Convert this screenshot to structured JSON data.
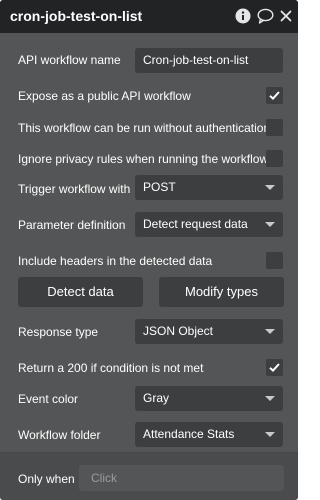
{
  "title": "cron-job-test-on-list",
  "icons": [
    "info-icon",
    "comment-icon",
    "close-icon"
  ],
  "fields": {
    "api_workflow_name": {
      "label": "API workflow name",
      "value": "Cron-job-test-on-list"
    },
    "expose_public": {
      "label": "Expose as a public API workflow",
      "checked": true
    },
    "no_auth": {
      "label": "This workflow can be run without authentication",
      "checked": false
    },
    "ignore_privacy": {
      "label": "Ignore privacy rules when running the workflow",
      "checked": false
    },
    "trigger": {
      "label": "Trigger workflow with",
      "value": "POST"
    },
    "parameter_definition": {
      "label": "Parameter definition",
      "value": "Detect request data"
    },
    "include_headers": {
      "label": "Include headers in the detected data",
      "checked": false
    },
    "response_type": {
      "label": "Response type",
      "value": "JSON Object"
    },
    "return_200": {
      "label": "Return a 200 if condition is not met",
      "checked": true
    },
    "event_color": {
      "label": "Event color",
      "value": "Gray"
    },
    "workflow_folder": {
      "label": "Workflow folder",
      "value": "Attendance Stats"
    }
  },
  "buttons": {
    "detect_data": "Detect data",
    "modify_types": "Modify types"
  },
  "only_when": {
    "label": "Only when",
    "placeholder": "Click"
  }
}
